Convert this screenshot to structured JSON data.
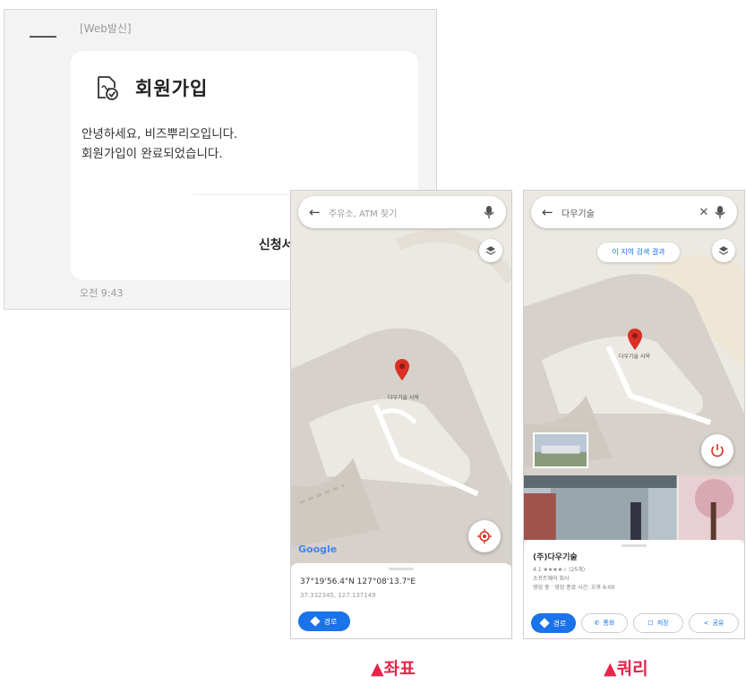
{
  "chat": {
    "sender": "[Web발신]",
    "title": "회원가입",
    "message_line1": "안녕하세요, 비즈뿌리오입니다.",
    "message_line2": "회원가입이 완료되었습니다.",
    "button": "신청서 제출처",
    "time": "오전 9:43"
  },
  "left_phone": {
    "search_placeholder": "주유소, ATM 찾기",
    "pin_label": "다우기술 사옥",
    "google_logo": "Google",
    "coordinates": "37°19'56.4\"N 127°08'13.7\"E",
    "coordinates_decimal": "37.332345, 127.137149",
    "directions_label": "경로",
    "caption": "▲좌표"
  },
  "right_phone": {
    "search_query": "다우기술",
    "area_search_label": "이 지역 검색 결과",
    "pin_label": "다우기술 사옥",
    "place_name": "(주)다우기술",
    "rating_text": "4.1 ★★★★☆ (25개)",
    "address_text": "소프트웨어 회사",
    "hours_text": "영업 중 · 영업 종료 시간: 오후 6:00",
    "directions_label": "경로",
    "call_label": "통화",
    "save_label": "저장",
    "share_label": "공유",
    "caption": "▲쿼리"
  },
  "colors": {
    "accent": "#1a73e8",
    "pin": "#d93025",
    "caption": "#e8244b"
  }
}
